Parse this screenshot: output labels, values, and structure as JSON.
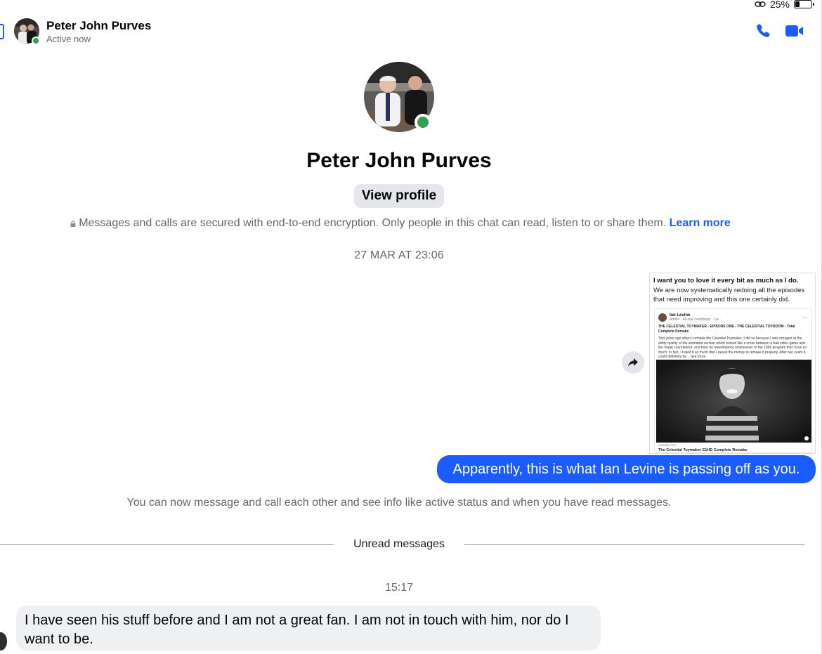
{
  "status_bar": {
    "battery": "25%"
  },
  "header": {
    "contact_name": "Peter John Purves",
    "status": "Active now"
  },
  "profile": {
    "name": "Peter John Purves",
    "view_profile_label": "View profile"
  },
  "encryption": {
    "text": "Messages and calls are secured with end-to-end encryption. Only people in this chat can read, listen to or share them.",
    "link": "Learn more"
  },
  "timestamp_1": "27 MAR AT 23:06",
  "shared_post": {
    "headline": "I want you to love it every bit as much as I do.",
    "body": "We are now systematically redoing all the episodes that need improving and this one certainly did.",
    "card": {
      "author": "Ian Levine",
      "author_meta": "Admin · All-star contributor · 1w · ",
      "title": "THE CELESTIAL TOYMAKER - EPISODE ONE - THE CELESTIAL TOYROOM - Total Complete Remake",
      "body": "Two years ago when I remade the Celestial Toymaker, I did so because I was enraged at the shitty quality of the animated version which looked like a cross between a bad video game and the magic roundabout, and bore no resemblance whatsoever to the 1966 program that I love so much. In fact, I hated it so much that I raised the money to remake it properly. After two years it could definitely be... See more",
      "link_url": "youtube.com",
      "link_title": "The Celestial Toymaker E1HD Complete Remake"
    }
  },
  "outgoing_message": "Apparently, this is what Ian Levine is passing off as you.",
  "system_note": "You can now message and call each other and see info like active status and when you have read messages.",
  "unread_label": "Unread messages",
  "timestamp_2": "15:17",
  "incoming_message": "I have seen his stuff before and I am not a great fan. I am not in touch with him, nor do I want to be.",
  "colors": {
    "accent": "#1a5cff",
    "presence": "#31a24c",
    "bubble_in": "#eff0f2",
    "muted_text": "#65676b"
  },
  "icons": [
    "back-icon",
    "phone-icon",
    "video-camera-icon",
    "lock-icon",
    "share-icon",
    "link-icon",
    "battery-icon"
  ]
}
